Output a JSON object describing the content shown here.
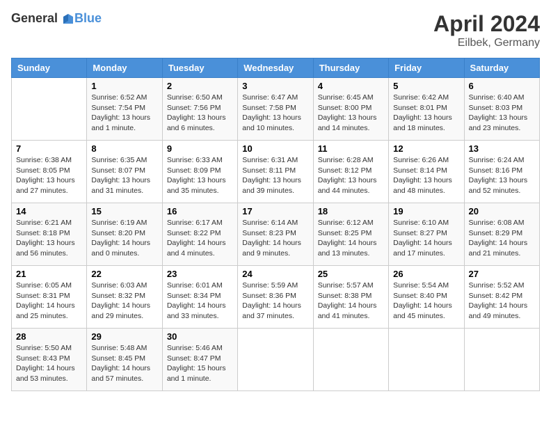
{
  "header": {
    "logo_line1": "General",
    "logo_line2": "Blue",
    "month": "April 2024",
    "location": "Eilbek, Germany"
  },
  "days_of_week": [
    "Sunday",
    "Monday",
    "Tuesday",
    "Wednesday",
    "Thursday",
    "Friday",
    "Saturday"
  ],
  "weeks": [
    [
      {
        "day": "",
        "info": ""
      },
      {
        "day": "1",
        "info": "Sunrise: 6:52 AM\nSunset: 7:54 PM\nDaylight: 13 hours\nand 1 minute."
      },
      {
        "day": "2",
        "info": "Sunrise: 6:50 AM\nSunset: 7:56 PM\nDaylight: 13 hours\nand 6 minutes."
      },
      {
        "day": "3",
        "info": "Sunrise: 6:47 AM\nSunset: 7:58 PM\nDaylight: 13 hours\nand 10 minutes."
      },
      {
        "day": "4",
        "info": "Sunrise: 6:45 AM\nSunset: 8:00 PM\nDaylight: 13 hours\nand 14 minutes."
      },
      {
        "day": "5",
        "info": "Sunrise: 6:42 AM\nSunset: 8:01 PM\nDaylight: 13 hours\nand 18 minutes."
      },
      {
        "day": "6",
        "info": "Sunrise: 6:40 AM\nSunset: 8:03 PM\nDaylight: 13 hours\nand 23 minutes."
      }
    ],
    [
      {
        "day": "7",
        "info": "Sunrise: 6:38 AM\nSunset: 8:05 PM\nDaylight: 13 hours\nand 27 minutes."
      },
      {
        "day": "8",
        "info": "Sunrise: 6:35 AM\nSunset: 8:07 PM\nDaylight: 13 hours\nand 31 minutes."
      },
      {
        "day": "9",
        "info": "Sunrise: 6:33 AM\nSunset: 8:09 PM\nDaylight: 13 hours\nand 35 minutes."
      },
      {
        "day": "10",
        "info": "Sunrise: 6:31 AM\nSunset: 8:11 PM\nDaylight: 13 hours\nand 39 minutes."
      },
      {
        "day": "11",
        "info": "Sunrise: 6:28 AM\nSunset: 8:12 PM\nDaylight: 13 hours\nand 44 minutes."
      },
      {
        "day": "12",
        "info": "Sunrise: 6:26 AM\nSunset: 8:14 PM\nDaylight: 13 hours\nand 48 minutes."
      },
      {
        "day": "13",
        "info": "Sunrise: 6:24 AM\nSunset: 8:16 PM\nDaylight: 13 hours\nand 52 minutes."
      }
    ],
    [
      {
        "day": "14",
        "info": "Sunrise: 6:21 AM\nSunset: 8:18 PM\nDaylight: 13 hours\nand 56 minutes."
      },
      {
        "day": "15",
        "info": "Sunrise: 6:19 AM\nSunset: 8:20 PM\nDaylight: 14 hours\nand 0 minutes."
      },
      {
        "day": "16",
        "info": "Sunrise: 6:17 AM\nSunset: 8:22 PM\nDaylight: 14 hours\nand 4 minutes."
      },
      {
        "day": "17",
        "info": "Sunrise: 6:14 AM\nSunset: 8:23 PM\nDaylight: 14 hours\nand 9 minutes."
      },
      {
        "day": "18",
        "info": "Sunrise: 6:12 AM\nSunset: 8:25 PM\nDaylight: 14 hours\nand 13 minutes."
      },
      {
        "day": "19",
        "info": "Sunrise: 6:10 AM\nSunset: 8:27 PM\nDaylight: 14 hours\nand 17 minutes."
      },
      {
        "day": "20",
        "info": "Sunrise: 6:08 AM\nSunset: 8:29 PM\nDaylight: 14 hours\nand 21 minutes."
      }
    ],
    [
      {
        "day": "21",
        "info": "Sunrise: 6:05 AM\nSunset: 8:31 PM\nDaylight: 14 hours\nand 25 minutes."
      },
      {
        "day": "22",
        "info": "Sunrise: 6:03 AM\nSunset: 8:32 PM\nDaylight: 14 hours\nand 29 minutes."
      },
      {
        "day": "23",
        "info": "Sunrise: 6:01 AM\nSunset: 8:34 PM\nDaylight: 14 hours\nand 33 minutes."
      },
      {
        "day": "24",
        "info": "Sunrise: 5:59 AM\nSunset: 8:36 PM\nDaylight: 14 hours\nand 37 minutes."
      },
      {
        "day": "25",
        "info": "Sunrise: 5:57 AM\nSunset: 8:38 PM\nDaylight: 14 hours\nand 41 minutes."
      },
      {
        "day": "26",
        "info": "Sunrise: 5:54 AM\nSunset: 8:40 PM\nDaylight: 14 hours\nand 45 minutes."
      },
      {
        "day": "27",
        "info": "Sunrise: 5:52 AM\nSunset: 8:42 PM\nDaylight: 14 hours\nand 49 minutes."
      }
    ],
    [
      {
        "day": "28",
        "info": "Sunrise: 5:50 AM\nSunset: 8:43 PM\nDaylight: 14 hours\nand 53 minutes."
      },
      {
        "day": "29",
        "info": "Sunrise: 5:48 AM\nSunset: 8:45 PM\nDaylight: 14 hours\nand 57 minutes."
      },
      {
        "day": "30",
        "info": "Sunrise: 5:46 AM\nSunset: 8:47 PM\nDaylight: 15 hours\nand 1 minute."
      },
      {
        "day": "",
        "info": ""
      },
      {
        "day": "",
        "info": ""
      },
      {
        "day": "",
        "info": ""
      },
      {
        "day": "",
        "info": ""
      }
    ]
  ]
}
